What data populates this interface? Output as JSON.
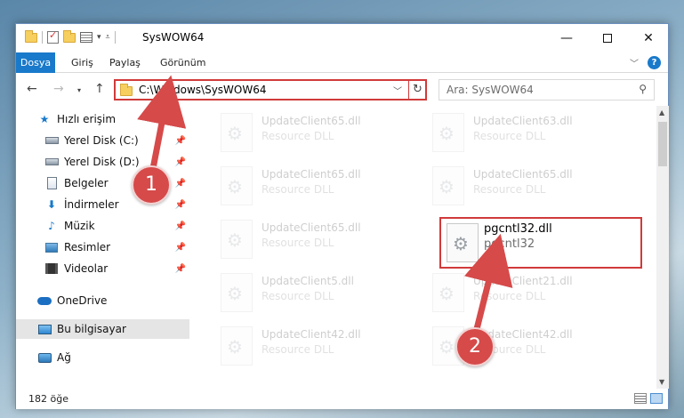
{
  "window": {
    "title": "SysWOW64"
  },
  "window_controls": {
    "minimize": "—",
    "close": "✕"
  },
  "ribbon": {
    "tabs": [
      "Dosya",
      "Giriş",
      "Paylaş",
      "Görünüm"
    ],
    "collapse": "﹀",
    "help": "?"
  },
  "nav": {
    "back": "←",
    "forward": "→",
    "recent": "▾",
    "up": "↑"
  },
  "address": {
    "path": "C:\\Windows\\SysWOW64",
    "dropdown": "﹀",
    "refresh": "↻"
  },
  "search": {
    "placeholder": "Ara: SysWOW64",
    "icon": "⚲"
  },
  "sidebar": {
    "items": [
      {
        "label": "Hızlı erişim",
        "icon": "star-icon"
      },
      {
        "label": "Yerel Disk (C:)",
        "icon": "drive-icon",
        "pin": "📌"
      },
      {
        "label": "Yerel Disk (D:)",
        "icon": "drive-icon",
        "pin": "📌"
      },
      {
        "label": "Belgeler",
        "icon": "documents-icon",
        "pin": "📌"
      },
      {
        "label": "İndirmeler",
        "icon": "download-icon",
        "pin": "📌"
      },
      {
        "label": "Müzik",
        "icon": "music-icon",
        "pin": "📌"
      },
      {
        "label": "Resimler",
        "icon": "pictures-icon",
        "pin": "📌"
      },
      {
        "label": "Videolar",
        "icon": "videos-icon",
        "pin": "📌"
      },
      {
        "label": "OneDrive",
        "icon": "onedrive-icon"
      },
      {
        "label": "Bu bilgisayar",
        "icon": "computer-icon"
      },
      {
        "label": "Ağ",
        "icon": "network-icon"
      }
    ]
  },
  "files": [
    {
      "name": "UpdateClient65.dll",
      "type": "Resource DLL"
    },
    {
      "name": "UpdateClient63.dll",
      "type": "Resource DLL"
    },
    {
      "name": "UpdateClient65.dll",
      "type": "Resource DLL"
    },
    {
      "name": "UpdateClient65.dll",
      "type": "Resource DLL"
    },
    {
      "name": "UpdateClient65.dll",
      "type": "Resource DLL"
    },
    {
      "name": "pgcntl32.dll",
      "type": "pgcntl32"
    },
    {
      "name": "UpdateClient5.dll",
      "type": "Resource DLL"
    },
    {
      "name": "UpdateClient21.dll",
      "type": "Resource DLL"
    },
    {
      "name": "UpdateClient42.dll",
      "type": "Resource DLL"
    },
    {
      "name": "UpdateClient42.dll",
      "type": "Resource DLL"
    }
  ],
  "status": {
    "count": "182 öğe"
  },
  "annotations": {
    "step1": "1",
    "step2": "2"
  },
  "colors": {
    "accent": "#1979ca",
    "highlight": "#d13a3a"
  }
}
